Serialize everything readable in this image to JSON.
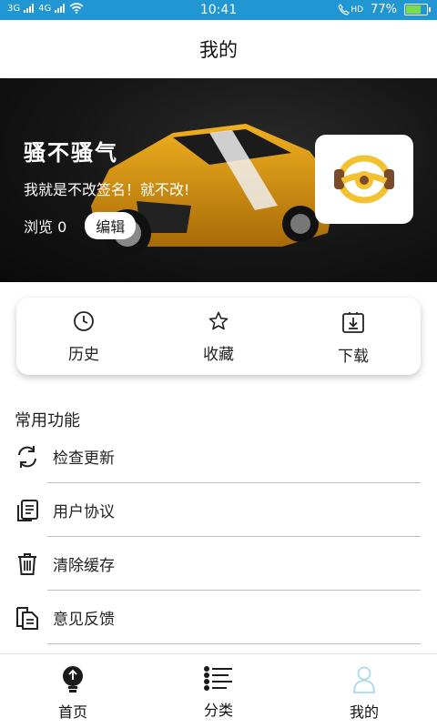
{
  "status_bar": {
    "signal_left": "3G",
    "signal_right": "4G",
    "time": "10:41",
    "hd_label": "HD",
    "battery_percent": "77%",
    "battery_level": 0.77,
    "battery_color": "#7ddc4a",
    "background": "#2196d3"
  },
  "header": {
    "title": "我的"
  },
  "profile": {
    "username": "骚不骚气",
    "signature": "我就是不改签名！就不改!",
    "views_label": "浏览 0",
    "edit_label": "编辑",
    "avatar_icon": "steering-wheel-icon",
    "accent": "#f2c230"
  },
  "quick_actions": [
    {
      "label": "历史",
      "icon": "clock-icon"
    },
    {
      "label": "收藏",
      "icon": "star-icon"
    },
    {
      "label": "下载",
      "icon": "download-icon"
    }
  ],
  "functions": {
    "section_title": "常用功能",
    "items": [
      {
        "label": "检查更新",
        "icon": "refresh-icon"
      },
      {
        "label": "用户协议",
        "icon": "document-icon"
      },
      {
        "label": "清除缓存",
        "icon": "trash-icon"
      },
      {
        "label": "意见反馈",
        "icon": "feedback-icon"
      }
    ]
  },
  "tab_bar": {
    "items": [
      {
        "label": "首页",
        "icon": "bulb-icon",
        "active": false
      },
      {
        "label": "分类",
        "icon": "list-icon",
        "active": false
      },
      {
        "label": "我的",
        "icon": "person-icon",
        "active": true
      }
    ],
    "active_icon_color": "#a9d8ef"
  }
}
